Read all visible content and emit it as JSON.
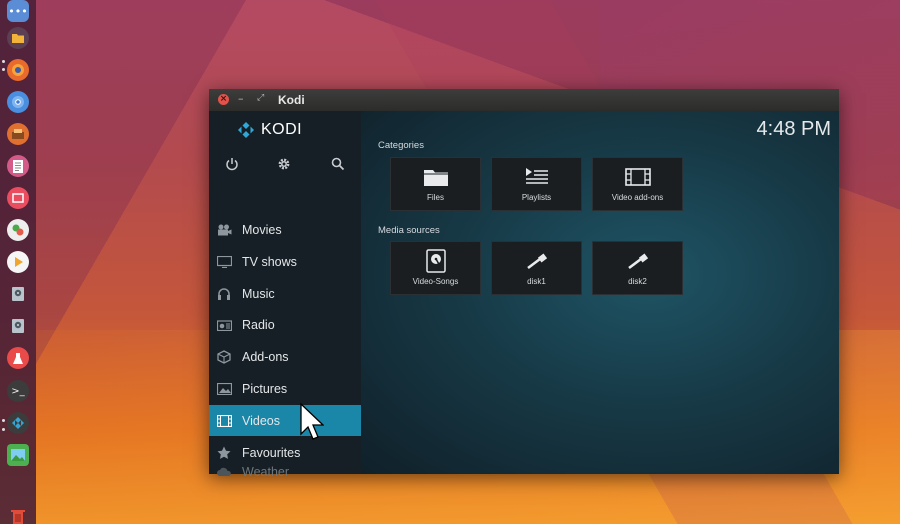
{
  "colors": {
    "accent": "#1a86a8",
    "sidebar_bg": "#161f25",
    "tile_bg": "#1a1e21"
  },
  "launcher": {
    "icons": [
      {
        "name": "dash-icon",
        "color": "#5b8cd6"
      },
      {
        "name": "files-icon",
        "color": "#e8a13a"
      },
      {
        "name": "firefox-icon",
        "color": "#e86a2c"
      },
      {
        "name": "chromium-icon",
        "color": "#4a8ee0"
      },
      {
        "name": "app-icon",
        "color": "#e07030"
      },
      {
        "name": "text-editor-icon",
        "color": "#d45a8a"
      },
      {
        "name": "screenshot-icon",
        "color": "#ea4d5f"
      },
      {
        "name": "app-switch-icon",
        "color": "#49a94c"
      },
      {
        "name": "vlc-icon",
        "color": "#f0a52e"
      },
      {
        "name": "disk-icon",
        "color": "#8b9ba8"
      },
      {
        "name": "disk-icon-2",
        "color": "#8b9ba8"
      },
      {
        "name": "flask-icon",
        "color": "#e94a4a"
      },
      {
        "name": "terminal-icon",
        "color": "#444"
      },
      {
        "name": "kodi-icon",
        "color": "#2f7fb0"
      },
      {
        "name": "image-viewer-icon",
        "color": "#4caf50"
      },
      {
        "name": "trash-icon",
        "color": "#e14c3a"
      }
    ]
  },
  "window": {
    "title": "Kodi",
    "close_glyph": "×",
    "min_glyph": "–",
    "max_glyph": "⤢"
  },
  "sidebar": {
    "logo": "KODI",
    "top_icons": [
      "power-icon",
      "gear-icon",
      "search-icon"
    ],
    "items": [
      {
        "label": "Movies",
        "icon": "movies-icon"
      },
      {
        "label": "TV shows",
        "icon": "tv-icon"
      },
      {
        "label": "Music",
        "icon": "headphones-icon"
      },
      {
        "label": "Radio",
        "icon": "radio-icon"
      },
      {
        "label": "Add-ons",
        "icon": "addons-icon"
      },
      {
        "label": "Pictures",
        "icon": "pictures-icon"
      },
      {
        "label": "Videos",
        "icon": "film-icon",
        "active": true
      },
      {
        "label": "Favourites",
        "icon": "star-icon"
      },
      {
        "label": "Weather",
        "icon": "weather-icon",
        "faded": true
      }
    ]
  },
  "main": {
    "clock": "4:48 PM",
    "categories_label": "Categories",
    "categories": [
      {
        "label": "Files",
        "icon": "folder-icon"
      },
      {
        "label": "Playlists",
        "icon": "playlist-icon"
      },
      {
        "label": "Video add-ons",
        "icon": "film-strip-icon"
      }
    ],
    "media_label": "Media sources",
    "media": [
      {
        "label": "Video-Songs",
        "icon": "harddisk-icon"
      },
      {
        "label": "disk1",
        "icon": "usb-icon"
      },
      {
        "label": "disk2",
        "icon": "usb-icon"
      }
    ]
  }
}
